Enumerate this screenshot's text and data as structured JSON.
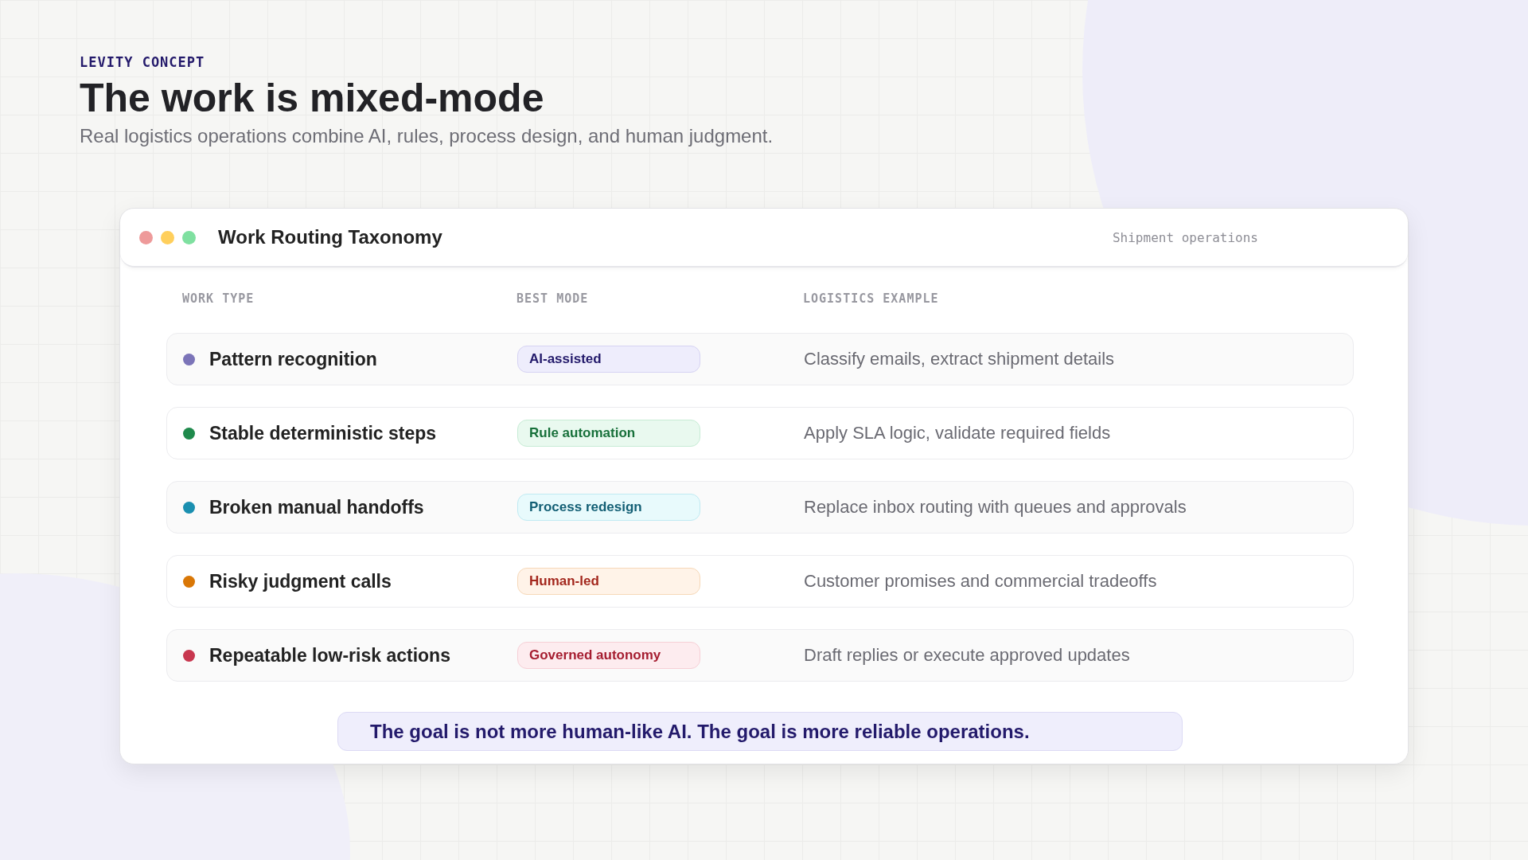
{
  "eyebrow": "LEVITY CONCEPT",
  "title": "The work is mixed-mode",
  "subtitle": "Real logistics operations combine AI, rules, process design, and human judgment.",
  "window": {
    "title": "Work Routing Taxonomy",
    "context": "Shipment operations"
  },
  "table": {
    "columns": [
      "WORK TYPE",
      "BEST MODE",
      "LOGISTICS EXAMPLE"
    ],
    "rows": [
      {
        "work_type": "Pattern recognition",
        "color": "#7b74b8",
        "mode": {
          "label": "AI-assisted",
          "kind": "ai"
        },
        "example": "Classify emails, extract shipment details"
      },
      {
        "work_type": "Stable deterministic steps",
        "color": "#1f8a4c",
        "mode": {
          "label": "Rule automation",
          "kind": "rule"
        },
        "example": "Apply SLA logic, validate required fields"
      },
      {
        "work_type": "Broken manual handoffs",
        "color": "#1a8fb0",
        "mode": {
          "label": "Process redesign",
          "kind": "process"
        },
        "example": "Replace inbox routing with queues and approvals"
      },
      {
        "work_type": "Risky judgment calls",
        "color": "#d97706",
        "mode": {
          "label": "Human-led",
          "kind": "human"
        },
        "example": "Customer promises and commercial tradeoffs"
      },
      {
        "work_type": "Repeatable low-risk actions",
        "color": "#c8374f",
        "mode": {
          "label": "Governed autonomy",
          "kind": "governed"
        },
        "example": "Draft replies or execute approved updates"
      }
    ]
  },
  "callout": "The goal is not more human-like AI. The goal is more reliable operations."
}
